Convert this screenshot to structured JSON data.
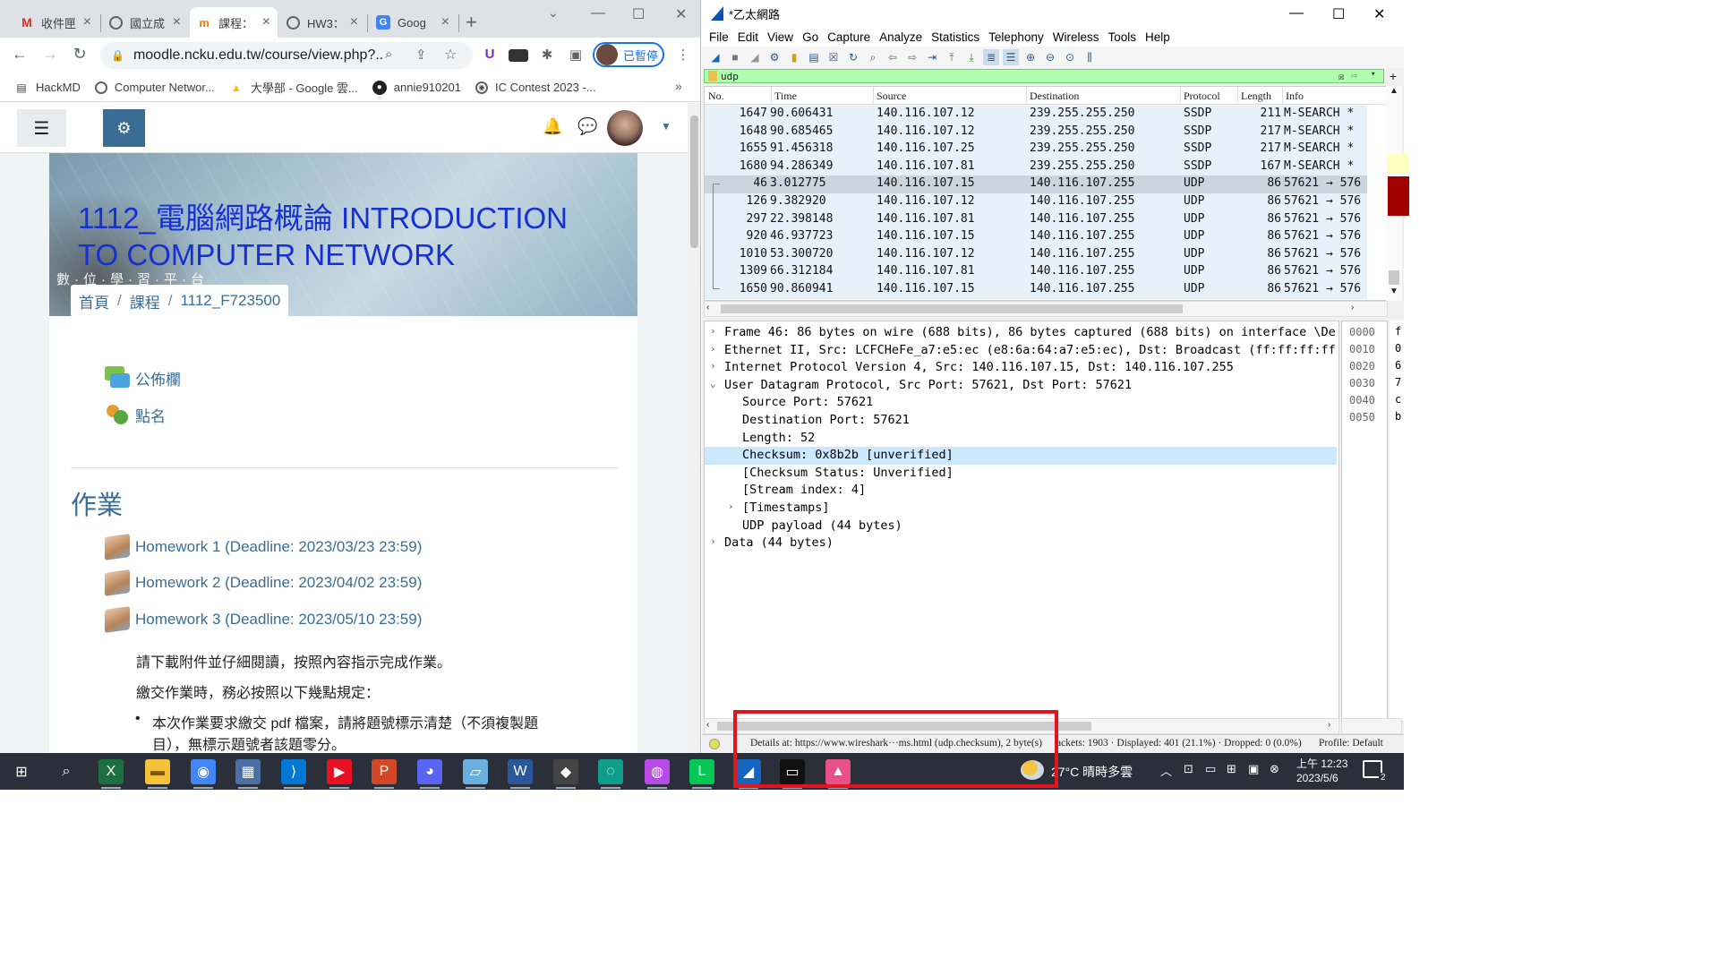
{
  "chrome": {
    "tabs": [
      {
        "title": "收件匣",
        "icon": "gmail-icon",
        "active": false
      },
      {
        "title": "國立成",
        "icon": "globe-icon",
        "active": false
      },
      {
        "title": "課程：",
        "icon": "moodle-icon",
        "active": true
      },
      {
        "title": "HW3：",
        "icon": "globe-icon",
        "active": false
      },
      {
        "title": "Goog",
        "icon": "google-translate-icon",
        "active": false
      }
    ],
    "url": "moodle.ncku.edu.tw/course/view.php?...",
    "profile_label": "已暫停",
    "bookmarks": [
      {
        "label": "HackMD",
        "icon": "document-icon"
      },
      {
        "label": "Computer Networ...",
        "icon": "globe-icon"
      },
      {
        "label": "大學部 - Google 雲...",
        "icon": "google-drive-icon"
      },
      {
        "label": "annie910201",
        "icon": "github-icon"
      },
      {
        "label": "IC Contest 2023 -...",
        "icon": "chip-icon"
      }
    ],
    "bookmarks_more": "»"
  },
  "moodle": {
    "course_title": "1112_電腦網路概論 INTRODUCTION TO COMPUTER NETWORK",
    "banner_tagline": "數·位·學·習·平·台",
    "breadcrumb": [
      "首頁",
      "課程",
      "1112_F723500"
    ],
    "activities": [
      {
        "label": "公佈欄",
        "icon": "forum-icon"
      },
      {
        "label": "點名",
        "icon": "attendance-icon"
      }
    ],
    "section_title": "作業",
    "assignments": [
      "Homework 1 (Deadline: 2023/03/23 23:59)",
      "Homework 2 (Deadline: 2023/04/02 23:59)",
      "Homework 3 (Deadline: 2023/05/10 23:59)"
    ],
    "para1": "請下載附件並仔細閱讀，按照內容指示完成作業。",
    "para2": "繳交作業時，務必按照以下幾點規定：",
    "bullet1_line1": "本次作業要求繳交 pdf 檔案，請將題號標示清楚（不須複製題",
    "bullet1_line2": "目），無標示題號者該題零分。"
  },
  "wireshark": {
    "title": "*乙太網路",
    "menu": [
      "File",
      "Edit",
      "View",
      "Go",
      "Capture",
      "Analyze",
      "Statistics",
      "Telephony",
      "Wireless",
      "Tools",
      "Help"
    ],
    "filter": "udp",
    "columns": [
      "No.",
      "Time",
      "Source",
      "Destination",
      "Protocol",
      "Length",
      "Info"
    ],
    "packets": [
      {
        "no": "1647",
        "time": "90.606431",
        "src": "140.116.107.12",
        "dst": "239.255.255.250",
        "proto": "SSDP",
        "len": "211",
        "info": "M-SEARCH *"
      },
      {
        "no": "1648",
        "time": "90.685465",
        "src": "140.116.107.12",
        "dst": "239.255.255.250",
        "proto": "SSDP",
        "len": "217",
        "info": "M-SEARCH *"
      },
      {
        "no": "1655",
        "time": "91.456318",
        "src": "140.116.107.25",
        "dst": "239.255.255.250",
        "proto": "SSDP",
        "len": "217",
        "info": "M-SEARCH *"
      },
      {
        "no": "1680",
        "time": "94.286349",
        "src": "140.116.107.81",
        "dst": "239.255.255.250",
        "proto": "SSDP",
        "len": "167",
        "info": "M-SEARCH *"
      },
      {
        "no": "46",
        "time": "3.012775",
        "src": "140.116.107.15",
        "dst": "140.116.107.255",
        "proto": "UDP",
        "len": "86",
        "info": "57621 → 576"
      },
      {
        "no": "126",
        "time": "9.382920",
        "src": "140.116.107.12",
        "dst": "140.116.107.255",
        "proto": "UDP",
        "len": "86",
        "info": "57621 → 576"
      },
      {
        "no": "297",
        "time": "22.398148",
        "src": "140.116.107.81",
        "dst": "140.116.107.255",
        "proto": "UDP",
        "len": "86",
        "info": "57621 → 576"
      },
      {
        "no": "920",
        "time": "46.937723",
        "src": "140.116.107.15",
        "dst": "140.116.107.255",
        "proto": "UDP",
        "len": "86",
        "info": "57621 → 576"
      },
      {
        "no": "1010",
        "time": "53.300720",
        "src": "140.116.107.12",
        "dst": "140.116.107.255",
        "proto": "UDP",
        "len": "86",
        "info": "57621 → 576"
      },
      {
        "no": "1309",
        "time": "66.312184",
        "src": "140.116.107.81",
        "dst": "140.116.107.255",
        "proto": "UDP",
        "len": "86",
        "info": "57621 → 576"
      },
      {
        "no": "1650",
        "time": "90.860941",
        "src": "140.116.107.15",
        "dst": "140.116.107.255",
        "proto": "UDP",
        "len": "86",
        "info": "57621 → 576"
      }
    ],
    "selected_packet_index": 4,
    "details": [
      {
        "text": "Frame 46: 86 bytes on wire (688 bits), 86 bytes captured (688 bits) on interface \\De",
        "arrow": "›",
        "indent": 0
      },
      {
        "text": "Ethernet II, Src: LCFCHeFe_a7:e5:ec (e8:6a:64:a7:e5:ec), Dst: Broadcast (ff:ff:ff:ff",
        "arrow": "›",
        "indent": 0
      },
      {
        "text": "Internet Protocol Version 4, Src: 140.116.107.15, Dst: 140.116.107.255",
        "arrow": "›",
        "indent": 0
      },
      {
        "text": "User Datagram Protocol, Src Port: 57621, Dst Port: 57621",
        "arrow": "⌄",
        "indent": 0
      },
      {
        "text": "Source Port: 57621",
        "arrow": "",
        "indent": 1
      },
      {
        "text": "Destination Port: 57621",
        "arrow": "",
        "indent": 1
      },
      {
        "text": "Length: 52",
        "arrow": "",
        "indent": 1
      },
      {
        "text": "Checksum: 0x8b2b [unverified]",
        "arrow": "",
        "indent": 1
      },
      {
        "text": "[Checksum Status: Unverified]",
        "arrow": "",
        "indent": 1
      },
      {
        "text": "[Stream index: 4]",
        "arrow": "",
        "indent": 1
      },
      {
        "text": "[Timestamps]",
        "arrow": "›",
        "indent": 1
      },
      {
        "text": "UDP payload (44 bytes)",
        "arrow": "",
        "indent": 1
      },
      {
        "text": "Data (44 bytes)",
        "arrow": "›",
        "indent": 0
      }
    ],
    "selected_detail_index": 7,
    "hex_offsets": [
      "0000",
      "0010",
      "0020",
      "0030",
      "0040",
      "0050"
    ],
    "hex_first_chars": [
      "f",
      "0",
      "6",
      "7",
      "c",
      "b"
    ],
    "status_details": "Details at: https://www.wireshark···ms.html (udp.checksum), 2 byte(s)",
    "status_packets": "ackets: 1903 · Displayed: 401 (21.1%) · Dropped: 0 (0.0%)",
    "status_profile": "Profile: Default"
  },
  "taskbar": {
    "apps": [
      "windows-start-icon",
      "search-icon",
      "excel-icon",
      "file-explorer-icon",
      "chrome-icon",
      "calculator-icon",
      "vscode-icon",
      "media-player-icon",
      "powerpoint-icon",
      "discord-icon",
      "files-icon",
      "word-icon",
      "mplab-icon",
      "edge-icon",
      "messenger-icon",
      "line-icon",
      "wireshark-icon",
      "terminal-icon",
      "arc-icon"
    ],
    "weather": "27°C 晴時多雲",
    "time": "上午 12:23",
    "date": "2023/5/6",
    "notification_count": "2"
  }
}
